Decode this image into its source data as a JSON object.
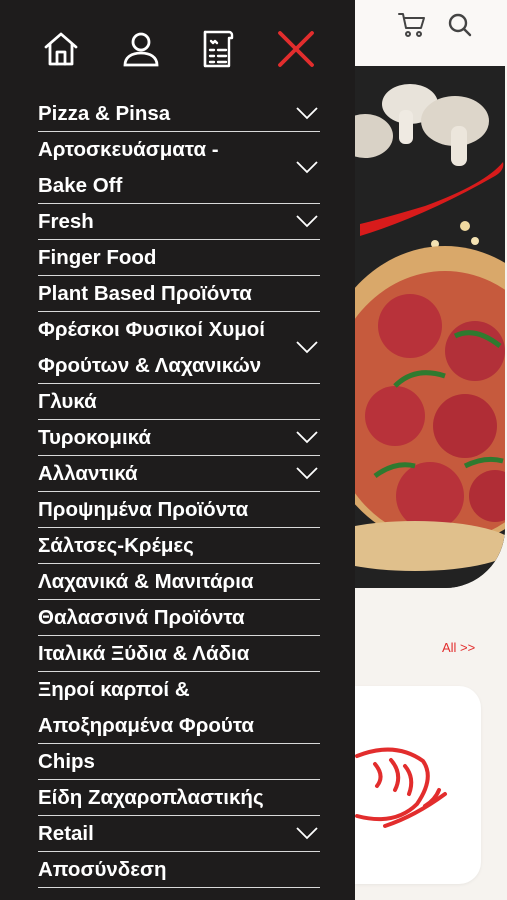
{
  "header": {
    "icons": [
      "home-icon",
      "user-icon",
      "menu-list-icon",
      "close-icon",
      "cart-icon",
      "search-icon"
    ]
  },
  "menu": {
    "items": [
      {
        "label": "Pizza & Pinsa",
        "expandable": true
      },
      {
        "label": "Αρτοσκευάσματα - Bake Off",
        "expandable": true
      },
      {
        "label": "Fresh",
        "expandable": true
      },
      {
        "label": "Finger Food",
        "expandable": false
      },
      {
        "label": "Plant Based Προϊόντα",
        "expandable": false
      },
      {
        "label": "Φρέσκοι Φυσικοί Χυμοί Φρούτων & Λαχανικών",
        "expandable": true
      },
      {
        "label": "Γλυκά",
        "expandable": false
      },
      {
        "label": "Τυροκομικά",
        "expandable": true
      },
      {
        "label": "Αλλαντικά",
        "expandable": true
      },
      {
        "label": "Προψημένα Προϊόντα",
        "expandable": false
      },
      {
        "label": "Σάλτσες-Κρέμες",
        "expandable": false
      },
      {
        "label": "Λαχανικά & Μανιτάρια",
        "expandable": false
      },
      {
        "label": "Θαλασσινά Προϊόντα",
        "expandable": false
      },
      {
        "label": "Ιταλικά Ξύδια & Λάδια",
        "expandable": false
      },
      {
        "label": "Ξηροί καρποί & Αποξηραμένα Φρούτα",
        "expandable": false
      },
      {
        "label": "Chips",
        "expandable": false
      },
      {
        "label": "Είδη Ζαχαροπλαστικής",
        "expandable": false
      },
      {
        "label": "Retail",
        "expandable": true
      },
      {
        "label": "Αποσύνδεση",
        "expandable": false
      }
    ]
  },
  "background": {
    "all_link": "All >>"
  },
  "colors": {
    "drawer_bg": "#1e1c1c",
    "accent_red": "#e22d2d",
    "divider": "#d9d9d9"
  }
}
